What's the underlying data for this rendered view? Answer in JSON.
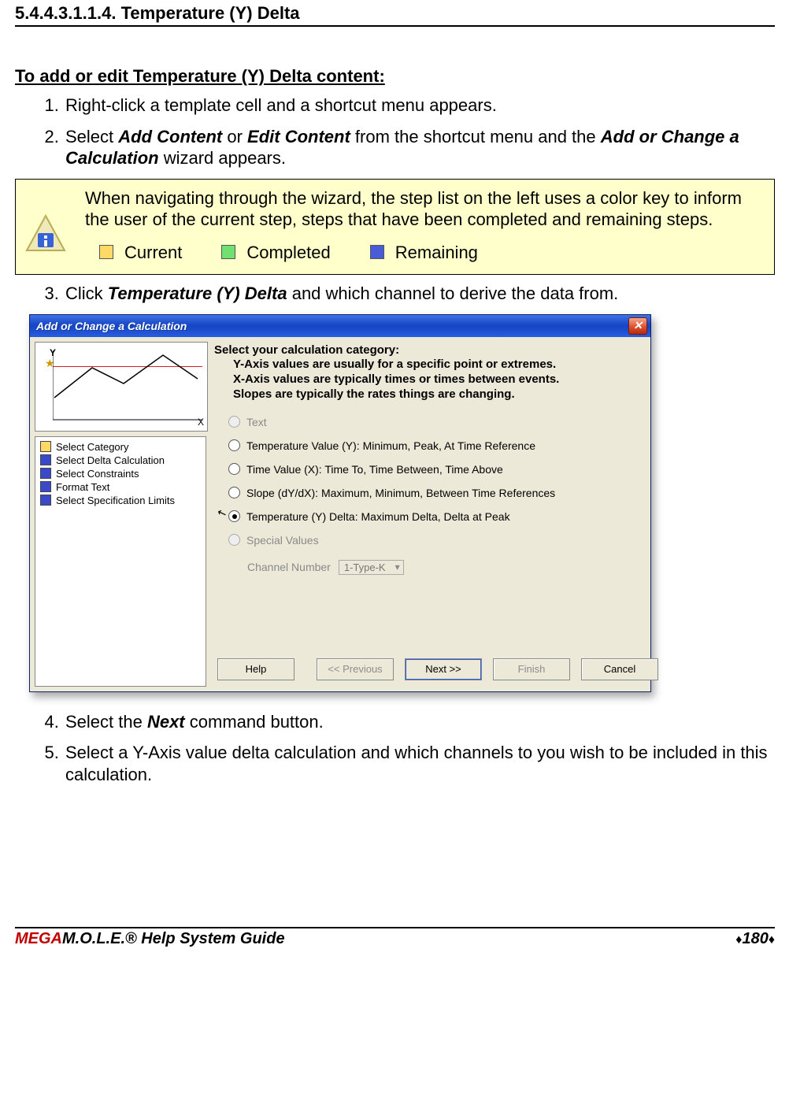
{
  "section": {
    "number": "5.4.4.3.1.1.4.",
    "title": "Temperature (Y) Delta"
  },
  "subhead": "To add or edit Temperature (Y) Delta content:",
  "steps": {
    "s1": "Right-click a template cell and a shortcut menu appears.",
    "s2_pre": "Select ",
    "s2_em1": "Add Content",
    "s2_mid1": " or ",
    "s2_em2": "Edit Content",
    "s2_mid2": " from the shortcut menu and the ",
    "s2_em3": "Add or Change a Calculation",
    "s2_post": " wizard appears.",
    "s3_pre": "Click ",
    "s3_em": "Temperature (Y) Delta",
    "s3_post": " and which channel to derive the data from.",
    "s4_pre": "Select the ",
    "s4_em": "Next",
    "s4_post": " command button.",
    "s5": "Select a Y-Axis value delta calculation and which channels to you wish to be included in this calculation."
  },
  "infobox": {
    "text": "When navigating through the wizard, the step list on the left uses a color key to inform the user of the current step, steps that have been completed and remaining steps.",
    "legend": {
      "current": "Current",
      "completed": "Completed",
      "remaining": "Remaining"
    }
  },
  "dialog": {
    "title": "Add or Change a Calculation",
    "thumb": {
      "y": "Y",
      "x": "X"
    },
    "steplist": [
      {
        "color": "yellow",
        "label": "Select Category"
      },
      {
        "color": "blue",
        "label": "Select Delta Calculation"
      },
      {
        "color": "blue",
        "label": "Select Constraints"
      },
      {
        "color": "blue",
        "label": "Format Text"
      },
      {
        "color": "blue",
        "label": "Select Specification Limits"
      }
    ],
    "category_header": {
      "line1": "Select your calculation category:",
      "line2": "Y-Axis values are usually for a specific point or extremes.",
      "line3": "X-Axis values are typically times or times between events.",
      "line4": "Slopes are typically the rates things are changing."
    },
    "options": {
      "text": "Text",
      "tempY": "Temperature Value (Y):  Minimum, Peak, At Time Reference",
      "timeX": "Time Value (X):  Time To, Time Between, Time Above",
      "slope": "Slope (dY/dX):  Maximum, Minimum, Between Time References",
      "tempDelta": "Temperature (Y) Delta:  Maximum Delta, Delta at Peak",
      "special": "Special  Values",
      "channel_label": "Channel Number",
      "channel_value": "1-Type-K"
    },
    "buttons": {
      "help": "Help",
      "prev": "<< Previous",
      "next": "Next >>",
      "finish": "Finish",
      "cancel": "Cancel"
    }
  },
  "footer": {
    "left_mega": "MEGA",
    "left_rest": "M.O.L.E.® Help System Guide",
    "page": "180"
  }
}
